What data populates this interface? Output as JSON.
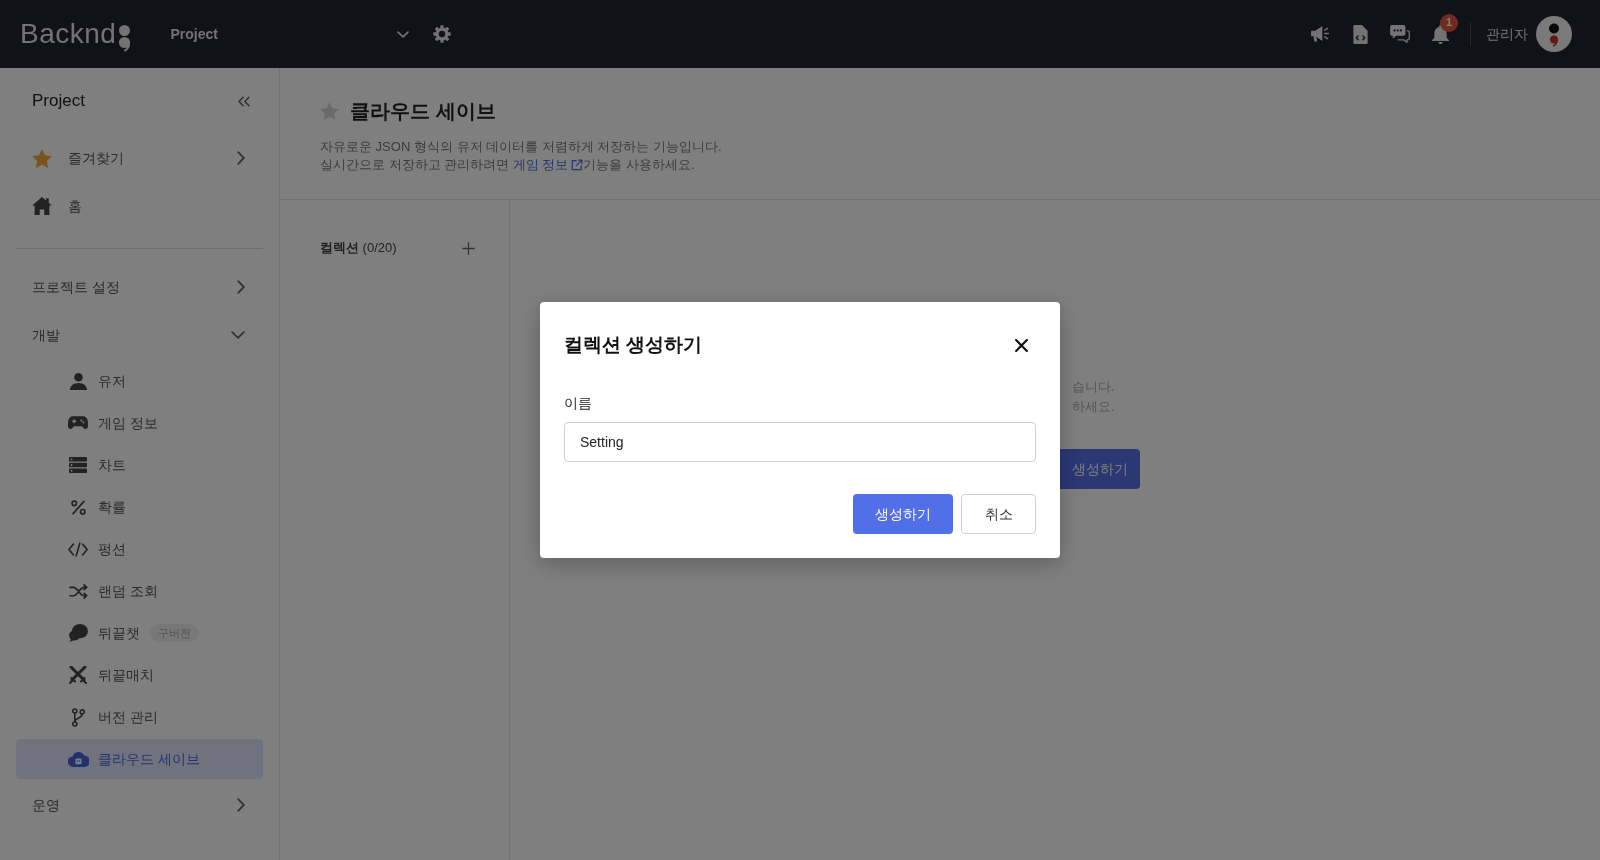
{
  "topbar": {
    "logo": "Backnd",
    "project": "Project",
    "notification_count": "1",
    "user": "관리자"
  },
  "sidebar": {
    "title": "Project",
    "shortcuts": [
      {
        "label": "즐겨찾기",
        "kind": "group",
        "expanded": false
      },
      {
        "label": "홈",
        "kind": "link"
      }
    ],
    "sections": [
      {
        "label": "프로젝트 설정",
        "expanded": false
      },
      {
        "label": "개발",
        "expanded": true,
        "children": [
          {
            "label": "유저",
            "selected": false
          },
          {
            "label": "게임 정보",
            "selected": false
          },
          {
            "label": "차트",
            "selected": false
          },
          {
            "label": "확률",
            "selected": false
          },
          {
            "label": "펑션",
            "selected": false
          },
          {
            "label": "랜덤 조회",
            "selected": false
          },
          {
            "label": "뒤끝챗",
            "badge": "구버전",
            "selected": false
          },
          {
            "label": "뒤끝매치",
            "selected": false
          },
          {
            "label": "버전 관리",
            "selected": false
          },
          {
            "label": "클라우드 세이브",
            "selected": true
          }
        ]
      },
      {
        "label": "운영",
        "expanded": false
      }
    ]
  },
  "page": {
    "title": "클라우드 세이브",
    "favorite": false,
    "description": [
      {
        "text": "자유로운 JSON 형식의 유저 데이터를 저렴하게 저장하는 기능입니다."
      },
      {
        "text": "실시간으로 저장하고 관리하려면 ",
        "link": "게임 정보",
        "after": "기능을 사용하세요."
      }
    ]
  },
  "collections": {
    "heading": "**컬렉션** (0/20)"
  },
  "empty_state": {
    "lines": [
      "습니다.",
      "하세요."
    ],
    "button": "생성하기"
  },
  "modal": {
    "title": "컬렉션 생성하기",
    "field": {
      "label": "이름",
      "value": "Setting"
    },
    "buttons": [
      {
        "label": "생성하기",
        "kind": "primary"
      },
      {
        "label": "취소",
        "kind": "secondary"
      }
    ]
  }
}
